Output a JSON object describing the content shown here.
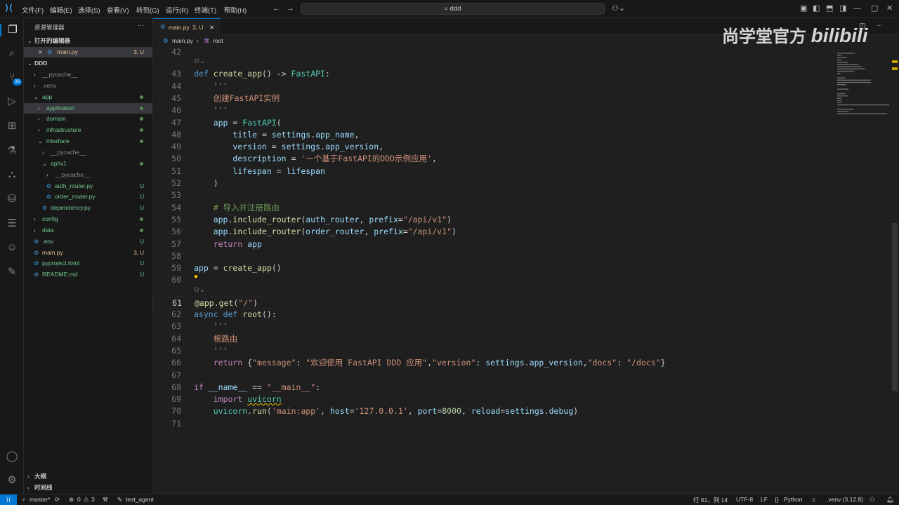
{
  "menu": [
    "文件(F)",
    "编辑(E)",
    "选择(S)",
    "查看(V)",
    "转到(G)",
    "运行(R)",
    "终端(T)",
    "帮助(H)"
  ],
  "search": {
    "text": "ddd"
  },
  "watermark": {
    "text": "尚学堂官方",
    "logo": "bilibili"
  },
  "activity": {
    "scm_badge": "33"
  },
  "sidebar": {
    "title": "资源管理器",
    "open_editors": "打开的编辑器",
    "open_file": "main.py",
    "open_file_status": "3, U",
    "root": "DDD",
    "items": [
      {
        "label": "__pycache__",
        "depth": 1,
        "folder": true,
        "open": false,
        "status": "",
        "color": "#8b8b8b"
      },
      {
        "label": ".venv",
        "depth": 1,
        "folder": true,
        "open": false,
        "status": "",
        "color": "#8b8b8b"
      },
      {
        "label": "app",
        "depth": 1,
        "folder": true,
        "open": true,
        "status": "dot",
        "color": "#73c991"
      },
      {
        "label": "application",
        "depth": 2,
        "folder": true,
        "open": false,
        "status": "dot",
        "color": "#73c991",
        "selected": true
      },
      {
        "label": "domain",
        "depth": 2,
        "folder": true,
        "open": false,
        "status": "dot",
        "color": "#73c991"
      },
      {
        "label": "infrastructure",
        "depth": 2,
        "folder": true,
        "open": false,
        "status": "dot",
        "color": "#73c991"
      },
      {
        "label": "interface",
        "depth": 2,
        "folder": true,
        "open": true,
        "status": "dot",
        "color": "#73c991"
      },
      {
        "label": "__pycache__",
        "depth": 3,
        "folder": true,
        "open": false,
        "status": "",
        "color": "#8b8b8b"
      },
      {
        "label": "api\\v1",
        "depth": 3,
        "folder": true,
        "open": true,
        "status": "dot",
        "color": "#73c991"
      },
      {
        "label": "__pycache__",
        "depth": 4,
        "folder": true,
        "open": false,
        "status": "",
        "color": "#8b8b8b"
      },
      {
        "label": "auth_router.py",
        "depth": 4,
        "folder": false,
        "status": "U",
        "color": "#73c991"
      },
      {
        "label": "order_router.py",
        "depth": 4,
        "folder": false,
        "status": "U",
        "color": "#73c991"
      },
      {
        "label": "dependency.py",
        "depth": 3,
        "folder": false,
        "status": "U",
        "color": "#73c991"
      },
      {
        "label": "config",
        "depth": 1,
        "folder": true,
        "open": false,
        "status": "dot",
        "color": "#73c991"
      },
      {
        "label": "data",
        "depth": 1,
        "folder": true,
        "open": false,
        "status": "dot",
        "color": "#73c991"
      },
      {
        "label": ".env",
        "depth": 1,
        "folder": false,
        "status": "U",
        "color": "#73c991"
      },
      {
        "label": "main.py",
        "depth": 1,
        "folder": false,
        "status": "3, U",
        "color": "#e2c08d"
      },
      {
        "label": "pyproject.toml",
        "depth": 1,
        "folder": false,
        "status": "U",
        "color": "#73c991"
      },
      {
        "label": "README.md",
        "depth": 1,
        "folder": false,
        "status": "U",
        "color": "#73c991"
      }
    ],
    "outline": "大纲",
    "timeline": "时间线"
  },
  "editor": {
    "tab": {
      "name": "main.py",
      "status": "3, U"
    },
    "breadcrumb": {
      "file": "main.py",
      "symbol": "root"
    },
    "lines": [
      {
        "n": "42",
        "html": ""
      },
      {
        "n": "43",
        "html": "<span class=\"kw\">def</span> <span class=\"fn\">create_app</span>() -> <span class=\"cls\">FastAPI</span>:"
      },
      {
        "n": "44",
        "html": "    <span class=\"str\">'''</span>"
      },
      {
        "n": "45",
        "html": "    <span class=\"str\">创建FastAPI实例</span>"
      },
      {
        "n": "46",
        "html": "    <span class=\"str\">'''</span>"
      },
      {
        "n": "47",
        "html": "    <span class=\"var\">app</span> = <span class=\"cls\">FastAPI</span>("
      },
      {
        "n": "48",
        "html": "        <span class=\"var\">title</span> = <span class=\"var\">settings</span>.<span class=\"var\">app_name</span>,"
      },
      {
        "n": "49",
        "html": "        <span class=\"var\">version</span> = <span class=\"var\">settings</span>.<span class=\"var\">app_version</span>,"
      },
      {
        "n": "50",
        "html": "        <span class=\"var\">description</span> = <span class=\"str\">'一个基于FastAPI的DDD示例应用'</span>,"
      },
      {
        "n": "51",
        "html": "        <span class=\"var\">lifespan</span> = <span class=\"var\">lifespan</span>"
      },
      {
        "n": "52",
        "html": "    )"
      },
      {
        "n": "53",
        "html": ""
      },
      {
        "n": "54",
        "html": "    <span class=\"cm\"># 导入并注册路由</span>"
      },
      {
        "n": "55",
        "html": "    <span class=\"var\">app</span>.<span class=\"fn\">include_router</span>(<span class=\"var\">auth_router</span>, <span class=\"var\">prefix</span>=<span class=\"str\">\"/api/v1\"</span>)"
      },
      {
        "n": "56",
        "html": "    <span class=\"var\">app</span>.<span class=\"fn\">include_router</span>(<span class=\"var\">order_router</span>, <span class=\"var\">prefix</span>=<span class=\"str\">\"/api/v1\"</span>)"
      },
      {
        "n": "57",
        "html": "    <span class=\"ctl\">return</span> <span class=\"var\">app</span>"
      },
      {
        "n": "58",
        "html": ""
      },
      {
        "n": "59",
        "html": "<span class=\"var\">app</span> = <span class=\"fn\">create_app</span>()"
      },
      {
        "n": "60",
        "html": ""
      },
      {
        "n": "61",
        "html": "<span class=\"fn\">@app</span>.<span class=\"fn\">get</span>(<span class=\"str\">\"/\"</span>)"
      },
      {
        "n": "62",
        "html": "<span class=\"kw\">async</span> <span class=\"kw\">def</span> <span class=\"fn\">root</span>():"
      },
      {
        "n": "63",
        "html": "    <span class=\"str\">'''</span>"
      },
      {
        "n": "64",
        "html": "    <span class=\"str\">根路由</span>"
      },
      {
        "n": "65",
        "html": "    <span class=\"str\">'''</span>"
      },
      {
        "n": "66",
        "html": "    <span class=\"ctl\">return</span> {<span class=\"str\">\"message\"</span>: <span class=\"str\">\"欢迎使用 FastAPI DDD 应用\"</span>,<span class=\"str\">\"version\"</span>: <span class=\"var\">settings</span>.<span class=\"var\">app_version</span>,<span class=\"str\">\"docs\"</span>: <span class=\"str\">\"/docs\"</span>}"
      },
      {
        "n": "67",
        "html": ""
      },
      {
        "n": "68",
        "html": "<span class=\"ctl\">if</span> <span class=\"var\">__name__</span> == <span class=\"str\">\"__main__\"</span>:"
      },
      {
        "n": "69",
        "html": "    <span class=\"ctl\">import</span> <span class=\"cls\" style=\"text-decoration:underline wavy #cca700\">uvicorn</span>"
      },
      {
        "n": "70",
        "html": "    <span class=\"cls\">uvicorn</span>.<span class=\"fn\">run</span>(<span class=\"str\">'main:app'</span>, <span class=\"var\">host</span>=<span class=\"str\">'127.0.0.1'</span>, <span class=\"var\">port</span>=<span class=\"num\">8000</span>, <span class=\"var\">reload</span>=<span class=\"var\">settings</span>.<span class=\"var\">debug</span>)"
      },
      {
        "n": "71",
        "html": ""
      }
    ],
    "active_line": "61"
  },
  "status": {
    "branch": "master*",
    "errors": "0",
    "warnings": "3",
    "agent": "test_agent",
    "position": "行 61，列 14",
    "encoding": "UTF-8",
    "eol": "LF",
    "language": "Python",
    "env": ".venv (3.12.8)"
  },
  "colors": {
    "accent": "#0078d4",
    "untracked": "#73c991",
    "modified": "#e2c08d"
  }
}
